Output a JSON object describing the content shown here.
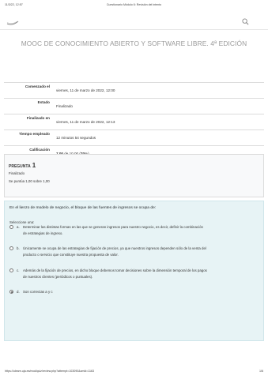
{
  "print_header": {
    "date": "11/3/22, 12:57",
    "title": "Cuestionario Módulo 6: Revisión del intento"
  },
  "header": {
    "course_title": "MOOC DE CONOCIMIENTO ABIERTO Y SOFTWARE LIBRE. 4ª EDICIÓN"
  },
  "summary": [
    {
      "label": "Comenzado el",
      "value": "viernes, 11 de marzo de 2022, 12:00"
    },
    {
      "label": "Estado",
      "value": "Finalizado"
    },
    {
      "label": "Finalizado en",
      "value": "viernes, 11 de marzo de 2022, 12:13"
    },
    {
      "label": "Tiempo empleado",
      "value": "12 minutos 54 segundos"
    },
    {
      "label": "Calificación",
      "value_bold": "7,00",
      "value_mid": " de 10,00 (",
      "value_pct": "70",
      "value_end": "%)"
    }
  ],
  "question": {
    "label": "PREGUNTA",
    "number": "1",
    "state": "Finalizado",
    "grade": "Se puntúa 1,00 sobre 1,00",
    "text": "En el lienzo de modelo de negocio, el bloque de las fuentes de ingresos se ocupa de:",
    "select_one": "Seleccione una:",
    "options": [
      {
        "letter": "a.",
        "line1": "Determinar las distintas formas en las que se generan ingresos para nuestro negocio, es decir, definir la combinación",
        "line2": "de estrategias de ingreso."
      },
      {
        "letter": "b.",
        "line1": "Únicamente se ocupa de las estrategias de fijación de precios, ya que nuestros ingresos dependen sólo de la venta del",
        "line2": "producto o servicio que constituye nuestra propuesta de valor."
      },
      {
        "letter": "c.",
        "line1": "Además de la fijación de precios, en dicho bloque debemos tomar decisiones sobre la dimensión temporal de los pagos",
        "line2": "de nuestros clientes (periódicos o puntuales)."
      },
      {
        "letter": "d.",
        "line1": "Son correctas a y c",
        "line2": ""
      }
    ]
  },
  "print_footer": {
    "url": "https://ulearn.uja.es/mod/quiz/review.php?attempt=103090&cmid=1163",
    "page": "1/6"
  }
}
